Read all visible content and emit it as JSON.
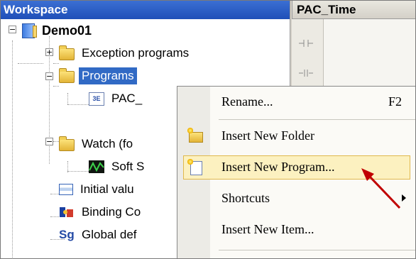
{
  "workspace": {
    "title": "Workspace",
    "tree": [
      {
        "label": "Demo01",
        "icon": "project-book-icon"
      },
      {
        "label": "Exception programs",
        "icon": "folder-icon"
      },
      {
        "label": "Programs",
        "icon": "folder-icon"
      },
      {
        "label": "PAC_",
        "icon": "program-icon"
      },
      {
        "label": "Watch (fo",
        "icon": "folder-icon"
      },
      {
        "label": "Soft S",
        "icon": "oscilloscope-icon"
      },
      {
        "label": "Initial valu",
        "icon": "grid-icon"
      },
      {
        "label": "Binding Co",
        "icon": "binding-icon"
      },
      {
        "label": "Global def",
        "icon": "sg-icon"
      }
    ]
  },
  "editor": {
    "tab_title": "PAC_Time"
  },
  "context_menu": {
    "items": [
      {
        "label": "Rename...",
        "shortcut": "F2"
      },
      {
        "label": "Insert New Folder"
      },
      {
        "label": "Insert New Program..."
      },
      {
        "label": "Shortcuts"
      },
      {
        "label": "Insert New Item..."
      }
    ],
    "highlighted_index": 2
  },
  "colors": {
    "selection": "#316ac5",
    "header_blue": "#1f4fb8",
    "annotation_arrow": "#c00000",
    "menu_highlight": "#fcf1c0"
  }
}
